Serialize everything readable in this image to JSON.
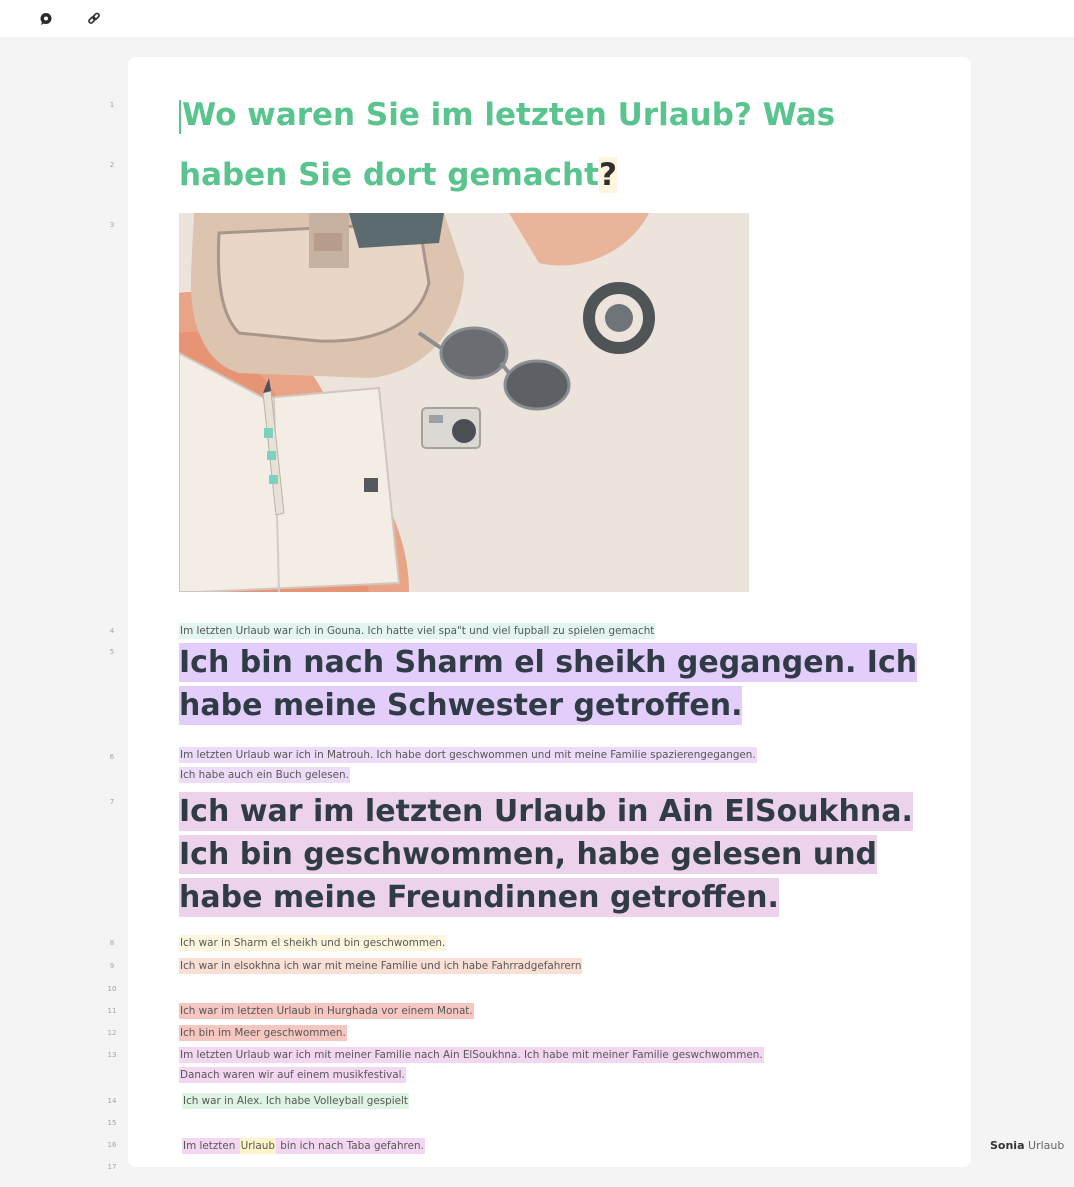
{
  "toolbar": {
    "comment_icon": "comment-icon",
    "link_icon": "link-icon"
  },
  "colors": {
    "title_green": "#59c48d",
    "hl_cyan": "#e3f5f1",
    "hl_purple": "#e2cdfb",
    "hl_lavender": "#eddcf8",
    "hl_pink": "#ecd2ea",
    "hl_cream": "#fff6dd",
    "hl_peach": "#fadfd5",
    "hl_salmon": "#f6c6c0",
    "hl_mauve": "#f3d7f1",
    "hl_mint": "#dff3e3",
    "hl_yellow": "#fff5c8"
  },
  "line_numbers": [
    "1",
    "2",
    "3",
    "4",
    "5",
    "6",
    "7",
    "8",
    "9",
    "10",
    "11",
    "12",
    "13",
    "14",
    "15",
    "16",
    "17"
  ],
  "title": {
    "line1": "Wo waren Sie im letzten Urlaub? Was",
    "line2_prefix": "haben Sie dort gemacht",
    "line2_mark": "?"
  },
  "image_alt": "Urlaubsfoto: Rucksack, Sonnenbrille, Notizbuch, Kamera",
  "answers": {
    "line4": "Im letzten Urlaub war ich in Gouna. Ich hatte viel spa\"t und viel fupball zu spielen gemacht",
    "line5a": "Ich bin nach Sharm el sheikh gegangen. Ich",
    "line5b": "habe meine Schwester getroffen.",
    "line6a": "Im letzten Urlaub war ich in Matrouh. Ich habe dort geschwommen und mit meine Familie spazierengegangen.",
    "line6b": "Ich habe auch ein Buch gelesen.",
    "line7a": "Ich war im letzten Urlaub in Ain ElSoukhna.",
    "line7b": "Ich bin geschwommen, habe gelesen und",
    "line7c": "habe meine Freundinnen getroffen.",
    "line8": "Ich war in Sharm el sheikh und bin geschwommen.",
    "line9": "Ich war in elsokhna ich war mit meine Familie und ich habe Fahrradgefahrern",
    "line11": "Ich war im letzten Urlaub in Hurghada vor einem Monat.",
    "line12": "Ich bin im Meer geschwommen.",
    "line13a": "Im letzten Urlaub war ich mit meiner Familie nach Ain ElSoukhna. Ich habe mit meiner Familie geswchwommen.",
    "line13b": "Danach waren wir auf einem musikfestival.",
    "line14": "Ich war in Alex. Ich habe Volleyball gespielt",
    "line16_pre": "Im letzten ",
    "line16_mark": "Urlaub",
    "line16_post": " bin ich nach Taba gefahren."
  },
  "side_comment": {
    "author": "Sonia",
    "text": "Urlaub"
  }
}
